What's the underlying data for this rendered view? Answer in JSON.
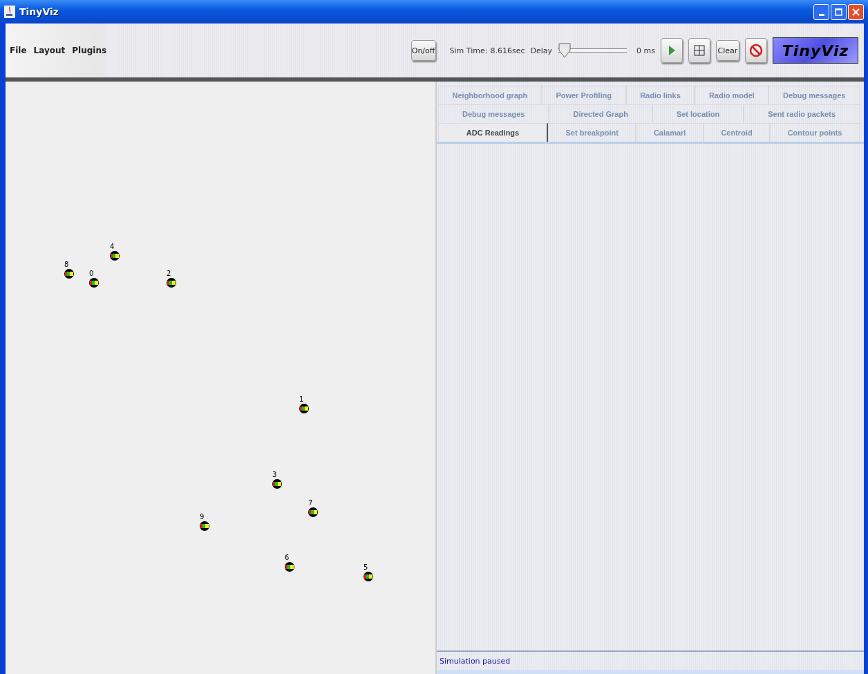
{
  "window": {
    "title": "TinyViz"
  },
  "menu": [
    "File",
    "Layout",
    "Plugins"
  ],
  "toolbar": {
    "onoff": "On/off",
    "sim_time_label": "Sim Time:",
    "sim_time": "8.616sec",
    "delay_label": "Delay",
    "delay": {
      "level": 0
    },
    "delay_reading": "0 ms",
    "clear": "Clear",
    "logo": "TinyViz"
  },
  "motes": [
    {
      "label": "8"
    },
    {
      "label": "0"
    },
    {
      "label": "4"
    },
    {
      "label": "2"
    },
    {
      "label": "1"
    },
    {
      "label": "3"
    },
    {
      "label": "7"
    },
    {
      "label": "9"
    },
    {
      "label": "6"
    },
    {
      "label": "5"
    }
  ],
  "tab_rows": [
    [
      {
        "label": "Neighborhood graph",
        "selected": false
      },
      {
        "label": "Power Profiling",
        "selected": false
      },
      {
        "label": "Radio links",
        "selected": false
      },
      {
        "label": "Radio model",
        "selected": false
      },
      {
        "label": "Debug messages",
        "selected": false
      }
    ],
    [
      {
        "label": "Debug messages",
        "selected": false
      },
      {
        "label": "Directed Graph",
        "selected": false
      },
      {
        "label": "Set location",
        "selected": false
      },
      {
        "label": "Sent radio packets",
        "selected": false
      }
    ],
    [
      {
        "label": "ADC Readings",
        "selected": true
      },
      {
        "label": "Set breakpoint",
        "selected": false
      },
      {
        "label": "Calamari",
        "selected": false
      },
      {
        "label": "Centroid",
        "selected": false
      },
      {
        "label": "Contour points",
        "selected": false
      }
    ]
  ],
  "status_bar": "Simulation paused"
}
